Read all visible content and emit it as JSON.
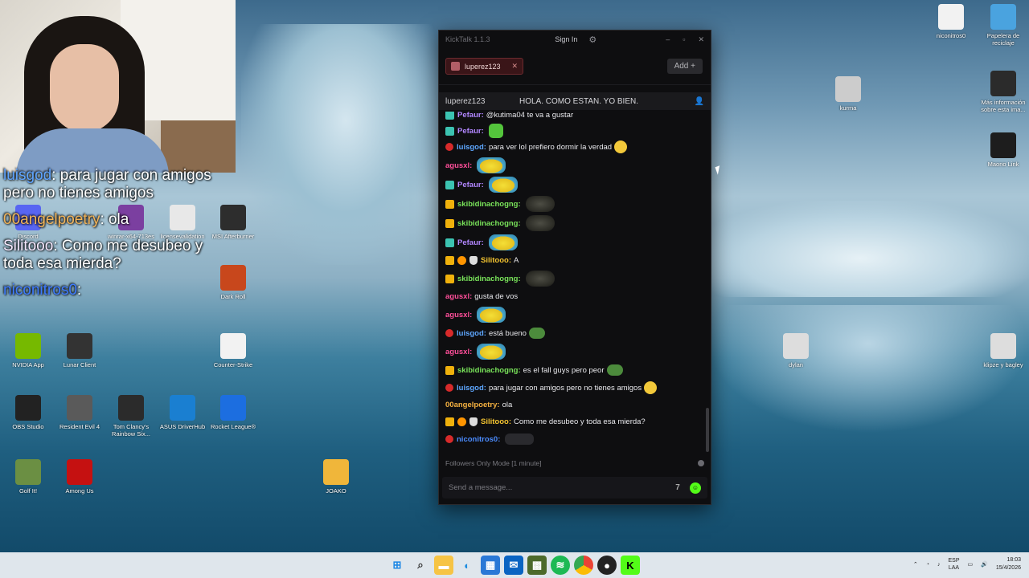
{
  "overlay": {
    "lines": [
      {
        "user": "luisgod",
        "text": ": para jugar con amigos pero no tienes amigos"
      },
      {
        "user": "00angelpoetry",
        "text": ": ola"
      },
      {
        "user": "Silitooo",
        "text": ": Como me desubeo y toda esa mierda?"
      },
      {
        "user": "niconitros0",
        "text": ":"
      }
    ]
  },
  "desktop": {
    "left_icons": [
      "Discord",
      "winrar-x64-713es",
      "licensevalidation",
      "MSI Afterburner",
      "Dark Roll",
      "NVIDIA App",
      "Lunar Client",
      "Counter-Strike",
      "OBS Studio",
      "Resident Evil 4",
      "Tom Clancy's Rainbow Six...",
      "ASUS DriverHub",
      "Rocket League®",
      "Golf It!",
      "Among Us",
      "JOAKO"
    ],
    "right_icons": [
      "niconitros0",
      "Papelera de reciclaje",
      "kurma",
      "Más información sobre esta ima...",
      "Maono Link",
      "dylan",
      "klipze y bagley"
    ]
  },
  "kicktalk": {
    "app_title": "KickTalk 1.1.3",
    "sign_in": "Sign In",
    "tab_name": "luperez123",
    "add_label": "Add +",
    "channel_name": "luperez123",
    "stream_title": "HOLA. COMO ESTAN. YO BIEN.",
    "messages": [
      {
        "badges": [
          "teal"
        ],
        "user": "Pefaur",
        "color": "#b287ff",
        "text": "@kutima04 te va a gustar",
        "emote": ""
      },
      {
        "badges": [
          "teal"
        ],
        "user": "Pefaur",
        "color": "#b287ff",
        "text": "",
        "emote": "green"
      },
      {
        "badges": [
          "red"
        ],
        "user": "luisgod",
        "color": "#5ea7ff",
        "text": "para ver lol prefiero dormir la verdad",
        "emote": "smile"
      },
      {
        "badges": [],
        "user": "agusxl",
        "color": "#ff4f9a",
        "text": "",
        "emote": "yellow"
      },
      {
        "badges": [
          "teal"
        ],
        "user": "Pefaur",
        "color": "#b287ff",
        "text": "",
        "emote": "yellow"
      },
      {
        "badges": [
          "gold"
        ],
        "user": "skibidinachogng",
        "color": "#79e35a",
        "text": "",
        "emote": "dark"
      },
      {
        "badges": [
          "gold"
        ],
        "user": "skibidinachogng",
        "color": "#79e35a",
        "text": "",
        "emote": "dark"
      },
      {
        "badges": [
          "teal"
        ],
        "user": "Pefaur",
        "color": "#b287ff",
        "text": "",
        "emote": "yellow"
      },
      {
        "badges": [
          "gold",
          "orange",
          "mask"
        ],
        "user": "Silitooo",
        "color": "#f4c430",
        "text": "A",
        "emote": ""
      },
      {
        "badges": [
          "gold"
        ],
        "user": "skibidinachogng",
        "color": "#79e35a",
        "text": "",
        "emote": "dark"
      },
      {
        "badges": [],
        "user": "agusxl",
        "color": "#ff4f9a",
        "text": "gusta de vos",
        "emote": ""
      },
      {
        "badges": [],
        "user": "agusxl",
        "color": "#ff4f9a",
        "text": "",
        "emote": "yellow"
      },
      {
        "badges": [
          "red"
        ],
        "user": "luisgod",
        "color": "#5ea7ff",
        "text": "está bueno",
        "emote": "frog"
      },
      {
        "badges": [],
        "user": "agusxl",
        "color": "#ff4f9a",
        "text": "",
        "emote": "yellow"
      },
      {
        "badges": [
          "gold"
        ],
        "user": "skibidinachogng",
        "color": "#79e35a",
        "text": "es el fall guys pero peor",
        "emote": "frog"
      },
      {
        "badges": [
          "red"
        ],
        "user": "luisgod",
        "color": "#5ea7ff",
        "text": "para jugar con amigos pero no tienes amigos",
        "emote": "smile"
      },
      {
        "badges": [],
        "user": "00angelpoetry",
        "color": "#f5b140",
        "text": "ola",
        "emote": ""
      },
      {
        "badges": [
          "gold",
          "orange",
          "mask"
        ],
        "user": "Silitooo",
        "color": "#f4c430",
        "text": "Como me desubeo y toda esa mierda?",
        "emote": ""
      },
      {
        "badges": [
          "red"
        ],
        "user": "niconitros0",
        "color": "#4b8cff",
        "text": "",
        "emote": "cars"
      }
    ],
    "mode_text": "Followers Only Mode [1 minute]",
    "input_placeholder": "Send a message..."
  },
  "taskbar": {
    "lang_top": "ESP",
    "lang_bottom": "LAA",
    "time": "18:03",
    "date": "15/4/2026"
  }
}
